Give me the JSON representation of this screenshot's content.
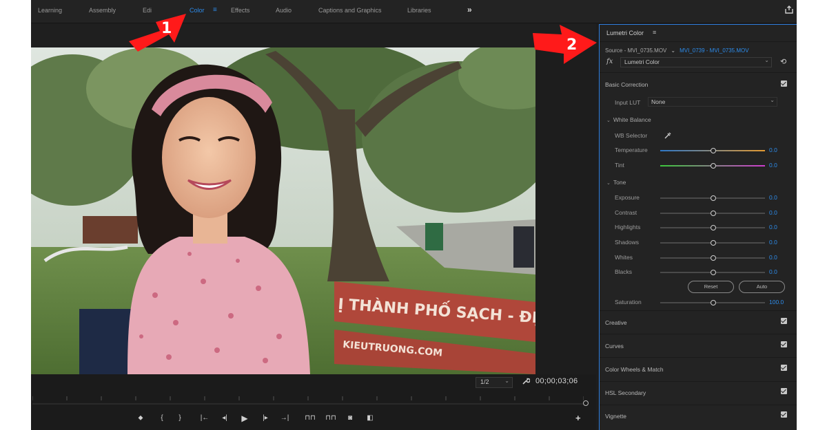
{
  "workspace_tabs": [
    "Learning",
    "Assembly",
    "Edi",
    "Color",
    "Effects",
    "Audio",
    "Captions and Graphics",
    "Libraries"
  ],
  "workspace_menu_glyph": "≡",
  "more_glyph": "»",
  "video": {
    "bench_text_1": "Ị THÀNH PHỐ SẠCH - ĐẸ",
    "bench_text_2": "KIEUTRUONG.COM"
  },
  "annotations": {
    "marker_1": "1",
    "marker_2": "2"
  },
  "monitor": {
    "zoom": "1/2",
    "timecode": "00;00;03;06"
  },
  "panel": {
    "title": "Lumetri Color",
    "source_label": "Source - MVI_0735.MOV",
    "sequence_label": "MVI_0739 - MVI_0735.MOV",
    "fx_label": "fx",
    "effect": "Lumetri Color",
    "basic_correction": "Basic Correction",
    "input_lut_label": "Input LUT",
    "input_lut_value": "None",
    "white_balance": "White Balance",
    "wb_selector": "WB Selector",
    "temperature": {
      "label": "Temperature",
      "value": "0.0"
    },
    "tint": {
      "label": "Tint",
      "value": "0.0"
    },
    "tone": "Tone",
    "tone_sliders": [
      {
        "label": "Exposure",
        "value": "0.0"
      },
      {
        "label": "Contrast",
        "value": "0.0"
      },
      {
        "label": "Highlights",
        "value": "0.0"
      },
      {
        "label": "Shadows",
        "value": "0.0"
      },
      {
        "label": "Whites",
        "value": "0.0"
      },
      {
        "label": "Blacks",
        "value": "0.0"
      }
    ],
    "reset_label": "Reset",
    "auto_label": "Auto",
    "saturation": {
      "label": "Saturation",
      "value": "100.0"
    },
    "sections": [
      "Creative",
      "Curves",
      "Color Wheels & Match",
      "HSL Secondary",
      "Vignette"
    ]
  },
  "colors": {
    "accent": "#2d8ceb",
    "annotation_arrow": "#ff1a1a",
    "panel_bg": "#232323"
  }
}
